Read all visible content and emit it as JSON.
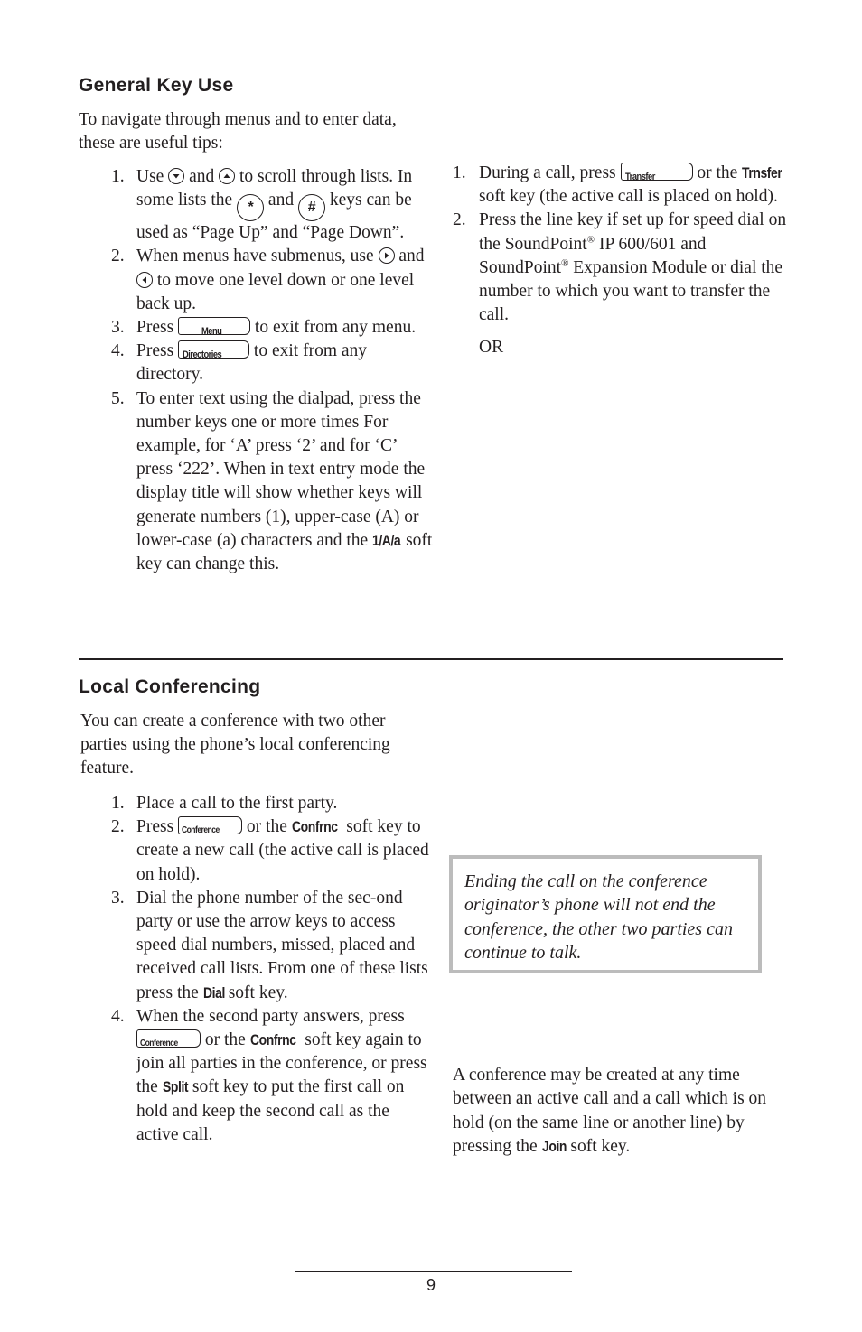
{
  "general_key_use": {
    "heading": "General Key Use",
    "intro": "To navigate through menus and to enter data, these are useful tips:",
    "items": [
      {
        "num": "1.",
        "t1": "Use ",
        "icon1": "down-arrow-key",
        "t2": " and ",
        "icon2": "up-arrow-key",
        "t3": " to scroll through lists. In some lists the ",
        "key_star": "*",
        "t4": " and ",
        "key_hash": "#",
        "t5": " keys can be used as “Page Up” and “Page Down”."
      },
      {
        "num": "2.",
        "t1": "When menus have submenus, use ",
        "icon1": "right-arrow-key",
        "t2": " and ",
        "icon2": "left-arrow-key",
        "t3": " to move one level down or one level back up."
      },
      {
        "num": "3.",
        "t1": "Press ",
        "key": "Menu",
        "t2": " to exit from any menu."
      },
      {
        "num": "4.",
        "t1": "Press ",
        "key": "Directories",
        "t2": " to exit from any directory."
      },
      {
        "num": "5.",
        "t1": "To enter text using the dialpad, press the number keys one or more times For example, for ‘A’ press ‘2’ and for ‘C’ press ‘222’.  When in text entry mode the display title will show whether keys will generate numbers (1), upper-case (A) or lower-case (a) characters and the ",
        "softkey": "1/A/a",
        "t2": " soft key can change this."
      }
    ]
  },
  "transfer": {
    "items": [
      {
        "num": "1.",
        "t1": "During a call, press ",
        "key": "Transfer",
        "t2": " or the ",
        "softkey": "Trnsfer",
        "t3": " soft key (the active call is placed on hold)."
      },
      {
        "num": "2.",
        "t1": "Press the line key if set up for speed dial on the SoundPoint",
        "reg": "®",
        "t2": " IP 600/601 and SoundPoint",
        "reg2": "®",
        "t3": " Expansion Module or dial the number to which you want to transfer the call."
      }
    ],
    "or": "OR"
  },
  "local_conferencing": {
    "heading": "Local Conferencing",
    "intro": "You can create a conference with two other parties using the phone’s local conferencing feature.",
    "items": [
      {
        "num": "1.",
        "t1": "Place a call to the first party."
      },
      {
        "num": "2.",
        "t1": "Press ",
        "key": "Conference",
        "t2": " or the ",
        "softkey": "Confrnc",
        "t3": " soft key to create a new call (the active call is placed on hold)."
      },
      {
        "num": "3.",
        "t1": "Dial the phone number of the sec-ond party or use the arrow keys to access speed dial numbers, missed, placed and received call lists.  From one of these lists press the ",
        "softkey": "Dial",
        "t2": " soft key."
      },
      {
        "num": "4.",
        "t1": "When the second party answers, press ",
        "key": "Conference",
        "t2": " or the ",
        "softkey": "Confrnc",
        "t3": " soft key again to join all parties in the conference, or press the ",
        "softkey2": "Split",
        "t4": " soft key to put the first call on hold and keep the second call as the active call."
      }
    ],
    "note": "Ending the call on the conference originator’s phone will not end the conference, the other two parties can continue to talk.",
    "join_para": {
      "t1": "A conference may be created at any time between an active call and a call which is on hold (on the same line or another line) by pressing the ",
      "softkey": "Join",
      "t2": " soft key."
    }
  },
  "footer": {
    "page_number": "9"
  }
}
